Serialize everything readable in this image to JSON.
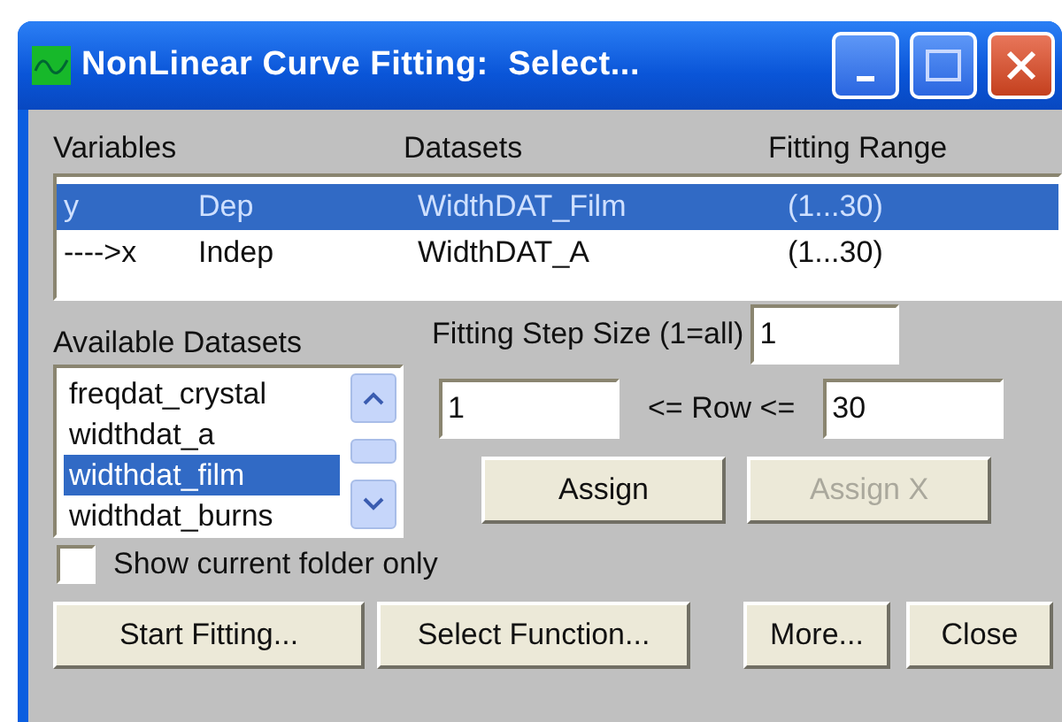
{
  "window": {
    "title": "NonLinear Curve Fitting:  Select..."
  },
  "variables_table": {
    "columns": [
      "Variables",
      "Datasets",
      "Fitting Range"
    ],
    "rows": [
      {
        "variable": "y",
        "role": "Dep",
        "dataset": "WidthDAT_Film",
        "range": "(1...30)",
        "selected": true
      },
      {
        "variable": "---->x",
        "role": "Indep",
        "dataset": "WidthDAT_A",
        "range": "(1...30)",
        "selected": false
      }
    ]
  },
  "available_datasets": {
    "label": "Available Datasets",
    "items": [
      {
        "name": "freqdat_crystal",
        "selected": false
      },
      {
        "name": "widthdat_a",
        "selected": false
      },
      {
        "name": "widthdat_film",
        "selected": true
      },
      {
        "name": "widthdat_burns",
        "selected": false
      }
    ]
  },
  "step_size": {
    "label": "Fitting Step Size (1=all)",
    "value": "1"
  },
  "row_range": {
    "from": "1",
    "label": "<= Row <=",
    "to": "30"
  },
  "assign_buttons": [
    {
      "label": "Assign",
      "disabled": false
    },
    {
      "label": "Assign X",
      "disabled": true
    }
  ],
  "show_current_folder_only": {
    "label": "Show current folder only",
    "checked": false
  },
  "buttons": [
    "Start Fitting...",
    "Select Function...",
    "More...",
    "Close"
  ]
}
